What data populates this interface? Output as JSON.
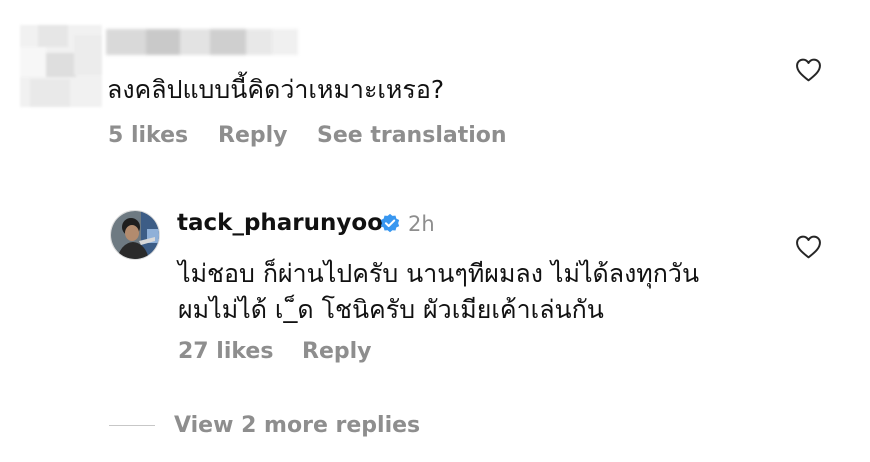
{
  "comment": {
    "text": "ลงคลิปแบบนี้คิดว่าเหมาะเหรอ?",
    "likes_label": "5 likes",
    "reply_label": "Reply",
    "translate_label": "See translation",
    "like_icon": "heart-outline-icon"
  },
  "reply": {
    "username": "tack_pharunyoo",
    "verified_icon": "verified-badge-icon",
    "time": "2h",
    "line1": "ไม่ชอบ ก็ผ่านไปครับ นานๆทีผมลง ไม่ได้ลงทุกวัน",
    "line2": "ผมไม่ได้ เ_็ด โชนิครับ ผัวเมียเค้าเล่นกัน",
    "likes_label": "27 likes",
    "reply_label": "Reply",
    "like_icon": "heart-outline-icon"
  },
  "view_more": {
    "label": "View 2 more replies"
  },
  "colors": {
    "text": "#111111",
    "secondary": "#8e8e8e",
    "verified": "#3897f0"
  }
}
